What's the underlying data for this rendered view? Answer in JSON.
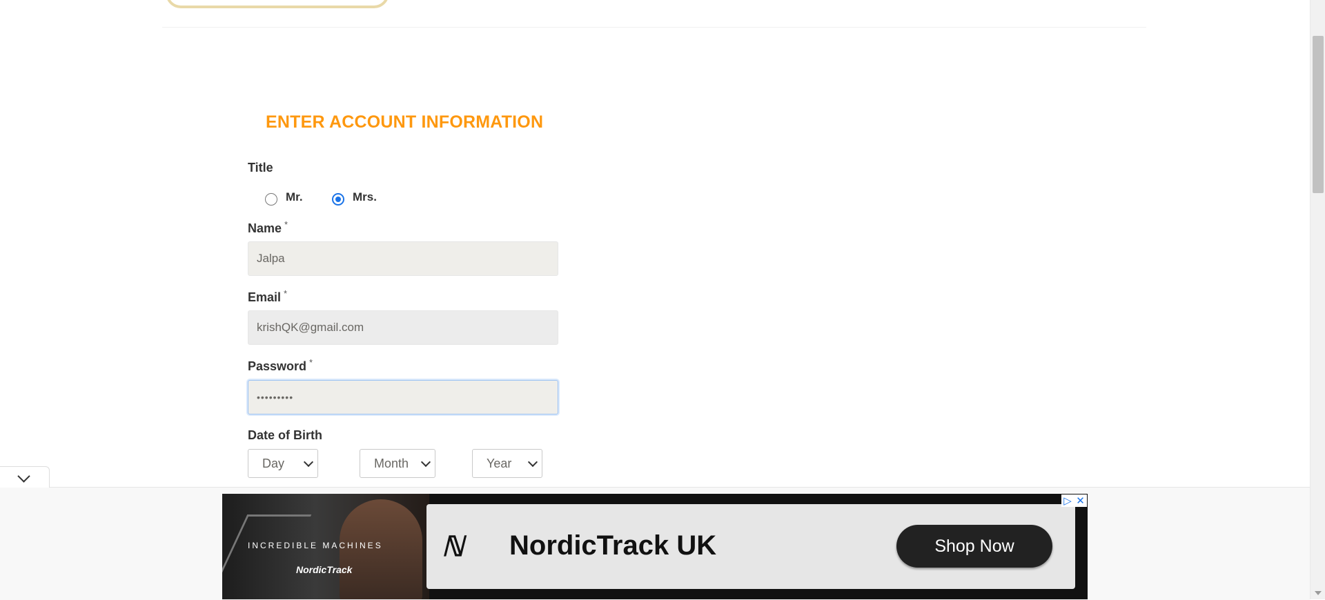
{
  "form": {
    "heading": "ENTER ACCOUNT INFORMATION",
    "title_label": "Title",
    "title_options": [
      "Mr.",
      "Mrs."
    ],
    "title_selected": "Mrs.",
    "name_label": "Name",
    "name_value": "Jalpa",
    "email_label": "Email",
    "email_value": "krishQK@gmail.com",
    "password_label": "Password",
    "password_value": "•••••••••",
    "required_mark": "*",
    "dob_label": "Date of Birth",
    "dob_day": "Day",
    "dob_month": "Month",
    "dob_year": "Year"
  },
  "ad": {
    "tagline": "INCREDIBLE MACHINES",
    "brand": "NordicTrack",
    "title": "NordicTrack UK",
    "cta": "Shop Now"
  },
  "colors": {
    "heading": "#fe980f",
    "radio_checked": "#1a73e8",
    "ad_button": "#222222"
  }
}
